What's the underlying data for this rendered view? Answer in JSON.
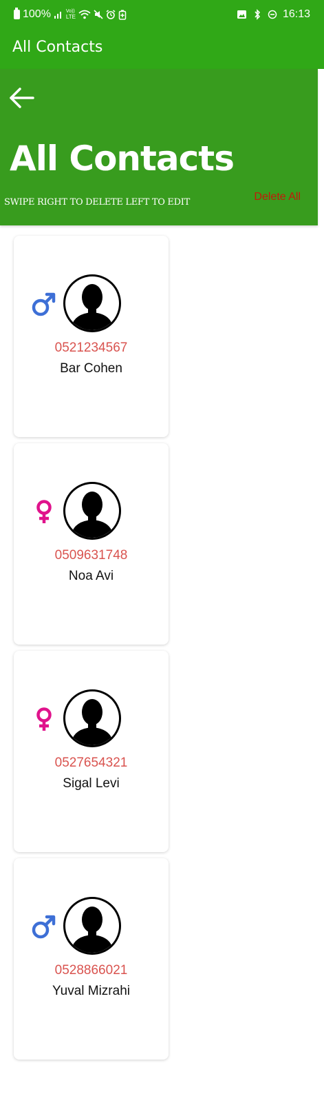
{
  "status_bar": {
    "battery": "100%",
    "net_badge_top": "Vo))",
    "net_badge_bottom": "LTE",
    "time": "16:13",
    "icons": [
      "battery-icon",
      "signal-icon",
      "wifi-icon",
      "mute-icon",
      "alarm-icon",
      "battery-saver-icon",
      "image-icon",
      "bluetooth-icon",
      "dnd-icon"
    ]
  },
  "app_bar": {
    "title": "All Contacts"
  },
  "header": {
    "title": "All Contacts",
    "hint": "SWIPE RIGHT TO DELETE LEFT TO EDIT",
    "delete_all_label": "Delete All",
    "back_icon": "back-arrow-icon"
  },
  "colors": {
    "app_bar": "#30a817",
    "header": "#389c1e",
    "phone_text": "#d9534f",
    "delete_all": "#c21a0a",
    "male": "#3d6fd6",
    "female": "#e0138c"
  },
  "contacts": [
    {
      "phone": "0521234567",
      "name": "Bar Cohen",
      "gender": "male"
    },
    {
      "phone": "0509631748",
      "name": "Noa Avi",
      "gender": "female"
    },
    {
      "phone": "0527654321",
      "name": "Sigal Levi",
      "gender": "female"
    },
    {
      "phone": "0528866021",
      "name": "Yuval Mizrahi",
      "gender": "male"
    }
  ]
}
